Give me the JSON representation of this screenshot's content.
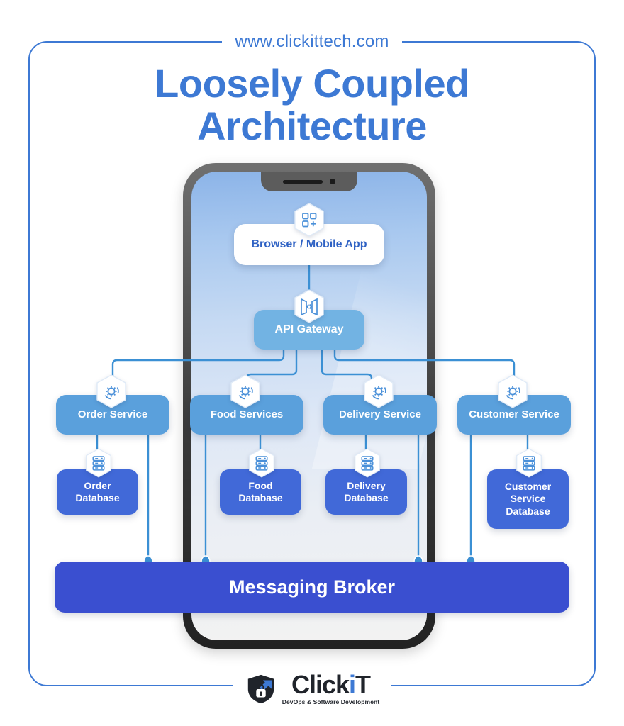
{
  "header": {
    "url": "www.clickittech.com"
  },
  "title": {
    "line1": "Loosely Coupled",
    "line2": "Architecture"
  },
  "diagram": {
    "client": {
      "label": "Browser / Mobile App",
      "icon": "apps-grid-plus-icon"
    },
    "gateway": {
      "label": "API Gateway",
      "icon": "gateway-code-icon"
    },
    "services": [
      {
        "label": "Order Service",
        "icon": "gear-sync-icon"
      },
      {
        "label": "Food Services",
        "icon": "gear-sync-icon"
      },
      {
        "label": "Delivery Service",
        "icon": "gear-sync-icon"
      },
      {
        "label": "Customer Service",
        "icon": "gear-sync-icon"
      }
    ],
    "databases": [
      {
        "label": "Order\nDatabase",
        "line1": "Order",
        "line2": "Database",
        "line3": "",
        "icon": "database-stack-icon"
      },
      {
        "label": "Food\nDatabase",
        "line1": "Food",
        "line2": "Database",
        "line3": "",
        "icon": "database-stack-icon"
      },
      {
        "label": "Delivery\nDatabase",
        "line1": "Delivery",
        "line2": "Database",
        "line3": "",
        "icon": "database-stack-icon"
      },
      {
        "label": "Customer\nService\nDatabase",
        "line1": "Customer",
        "line2": "Service",
        "line3": "Database",
        "icon": "database-stack-icon"
      }
    ],
    "broker": {
      "label": "Messaging Broker"
    }
  },
  "footer": {
    "brand_part1": "Click",
    "brand_i": "i",
    "brand_part2": "T",
    "tagline": "DevOps & Software Development",
    "logo_icon": "shield-lock-arrows-icon"
  },
  "colors": {
    "accent_blue": "#3d79d4",
    "client_box": "#ffffff",
    "gateway_box": "#72b3e3",
    "service_box": "#5aa0dc",
    "database_box": "#4169d8",
    "broker_box": "#3a4fd0",
    "wire": "#3b90d4",
    "phone_frame": "#3a3a3a"
  }
}
